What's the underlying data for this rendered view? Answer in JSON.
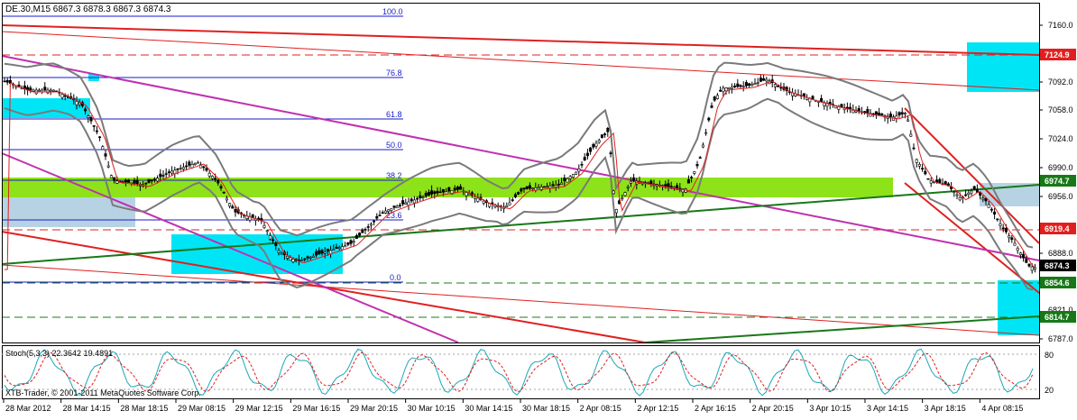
{
  "header": {
    "symbol_line": "DE.30,M15  6867.3 6878.3 6867.3 6874.3"
  },
  "indicator": {
    "label": "Stoch(5,3,3) 22.3642 19.4891",
    "levels": [
      "80",
      "20"
    ]
  },
  "copyright": "XTB-Trader, © 2001-2011 MetaQuotes Software Corp.",
  "fibonacci": [
    "100.0",
    "76.8",
    "61.8",
    "50.0",
    "38.2",
    "23.6",
    "0.0"
  ],
  "price_axis": {
    "ticks": [
      "7160.0",
      "7092.0",
      "7058.0",
      "7024.0",
      "6990.0",
      "6956.0",
      "6888.0",
      "6787.0",
      "6821.0"
    ],
    "markers": [
      {
        "text": "7124.9",
        "color": "#e02020"
      },
      {
        "text": "6974.7",
        "color": "#187818"
      },
      {
        "text": "6919.4",
        "color": "#e02020"
      },
      {
        "text": "6874.3",
        "color": "#000000"
      },
      {
        "text": "6854.6",
        "color": "#187818"
      },
      {
        "text": "6814.7",
        "color": "#187818"
      }
    ]
  },
  "time_axis": {
    "labels": [
      "28 Mar 2012",
      "28 Mar 14:15",
      "28 Mar 18:15",
      "29 Mar 08:15",
      "29 Mar 12:15",
      "29 Mar 16:15",
      "29 Mar 20:15",
      "30 Mar 10:15",
      "30 Mar 14:15",
      "30 Mar 18:15",
      "2 Apr 08:15",
      "2 Apr 12:15",
      "2 Apr 16:15",
      "2 Apr 20:15",
      "3 Apr 10:15",
      "3 Apr 14:15",
      "3 Apr 18:15",
      "4 Apr 08:15"
    ]
  },
  "colors": {
    "background": "#ffffff",
    "cyan_zone": "#00e5f5",
    "green_zone": "#8ee21a",
    "blue_zone": "#b7d3e3",
    "resistance": "#e02020",
    "support": "#187818",
    "magenta": "#c030b0",
    "bollinger": "#7a7a7a",
    "fib": "#1a1acd"
  }
}
